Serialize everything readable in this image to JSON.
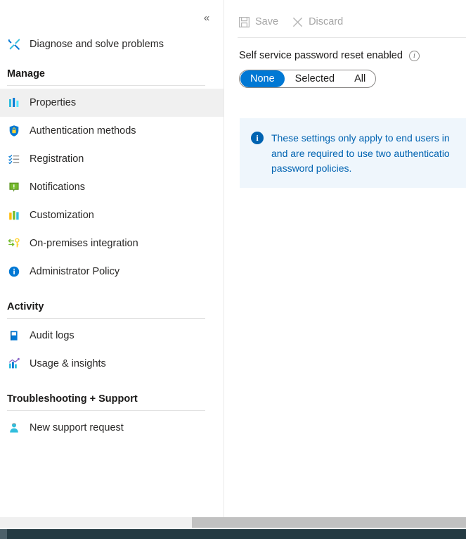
{
  "nav": {
    "collapse_icon": "double-chevron-left",
    "top_items": [
      {
        "label": "Diagnose and solve problems",
        "icon": "wrench-screwdriver-icon",
        "selected": false
      }
    ],
    "sections": [
      {
        "title": "Manage",
        "items": [
          {
            "label": "Properties",
            "icon": "properties-bars-icon",
            "selected": true
          },
          {
            "label": "Authentication methods",
            "icon": "shield-lock-icon",
            "selected": false
          },
          {
            "label": "Registration",
            "icon": "checklist-icon",
            "selected": false
          },
          {
            "label": "Notifications",
            "icon": "notification-bubble-icon",
            "selected": false
          },
          {
            "label": "Customization",
            "icon": "customization-bars-icon",
            "selected": false
          },
          {
            "label": "On-premises integration",
            "icon": "sync-key-icon",
            "selected": false
          },
          {
            "label": "Administrator Policy",
            "icon": "info-circle-icon",
            "selected": false
          }
        ]
      },
      {
        "title": "Activity",
        "items": [
          {
            "label": "Audit logs",
            "icon": "book-icon",
            "selected": false
          },
          {
            "label": "Usage & insights",
            "icon": "bar-chart-icon",
            "selected": false
          }
        ]
      },
      {
        "title": "Troubleshooting + Support",
        "items": [
          {
            "label": "New support request",
            "icon": "person-support-icon",
            "selected": false
          }
        ]
      }
    ]
  },
  "toolbar": {
    "save_label": "Save",
    "save_icon": "floppy-disk-icon",
    "save_disabled": true,
    "discard_label": "Discard",
    "discard_icon": "close-x-icon",
    "discard_disabled": true
  },
  "field": {
    "label": "Self service password reset enabled",
    "info_icon": "info-outline-icon",
    "info_glyph": "i",
    "options": [
      "None",
      "Selected",
      "All"
    ],
    "selected": "None"
  },
  "banner": {
    "icon": "info-filled-icon",
    "icon_glyph": "i",
    "text": "These settings only apply to end users in\nand are required to use two authenticatio\npassword policies."
  },
  "colors": {
    "accent": "#0078d4",
    "banner_bg": "#eff6fc",
    "banner_text": "#0063b1",
    "selected_row": "#f0f0f0",
    "disabled_text": "#a5a5a5",
    "taskbar": "#243a42"
  }
}
